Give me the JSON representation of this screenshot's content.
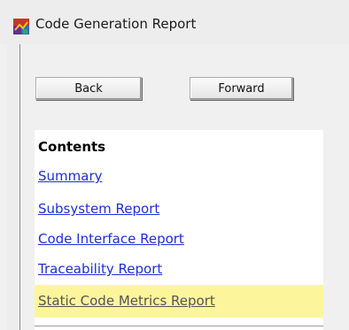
{
  "window": {
    "title": "Code Generation Report"
  },
  "toolbar": {
    "back_label": "Back",
    "forward_label": "Forward"
  },
  "contents": {
    "heading": "Contents",
    "links": [
      {
        "label": "Summary"
      },
      {
        "label": "Subsystem Report"
      },
      {
        "label": "Code Interface Report"
      },
      {
        "label": "Traceability Report"
      },
      {
        "label": "Static Code Metrics Report",
        "highlighted": true
      }
    ]
  },
  "colors": {
    "link": "#1f2fd6",
    "highlight": "#fdf59b",
    "highlight_text": "#555555"
  },
  "icons": {
    "app": "matlab-report-icon"
  }
}
